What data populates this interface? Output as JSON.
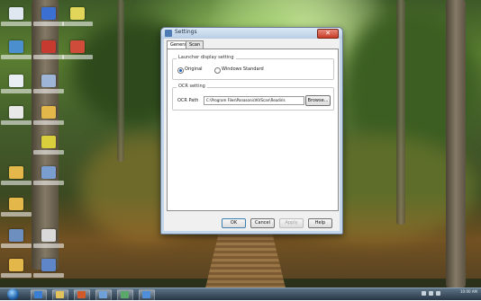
{
  "window": {
    "title": "Settings",
    "close_glyph": "✕",
    "tabs": [
      {
        "label": "General",
        "active": true
      },
      {
        "label": "Scan",
        "active": false
      }
    ],
    "launcher_group": {
      "label": "Launcher display setting",
      "options": [
        {
          "label": "Original",
          "selected": true
        },
        {
          "label": "Windows Standard",
          "selected": false
        }
      ]
    },
    "ocr_group": {
      "label": "OCR setting",
      "path_label": "OCR Path",
      "path_value": "C:\\Program Files\\Panasonic\\KVScan\\Readiris",
      "browse_label": "Browse..."
    },
    "buttons": {
      "ok": "OK",
      "cancel": "Cancel",
      "apply": "Apply",
      "help": "Help"
    }
  },
  "taskbar": {
    "time": "10:00 AM",
    "date": "",
    "pinned": [
      "ie-icon",
      "explorer-icon",
      "media-icon",
      "app-icon",
      "app-icon",
      "scanner-icon"
    ]
  },
  "colors": {
    "title_bar": "#c3d6ea",
    "close_button": "#c73b24",
    "taskbar": "#273646"
  }
}
